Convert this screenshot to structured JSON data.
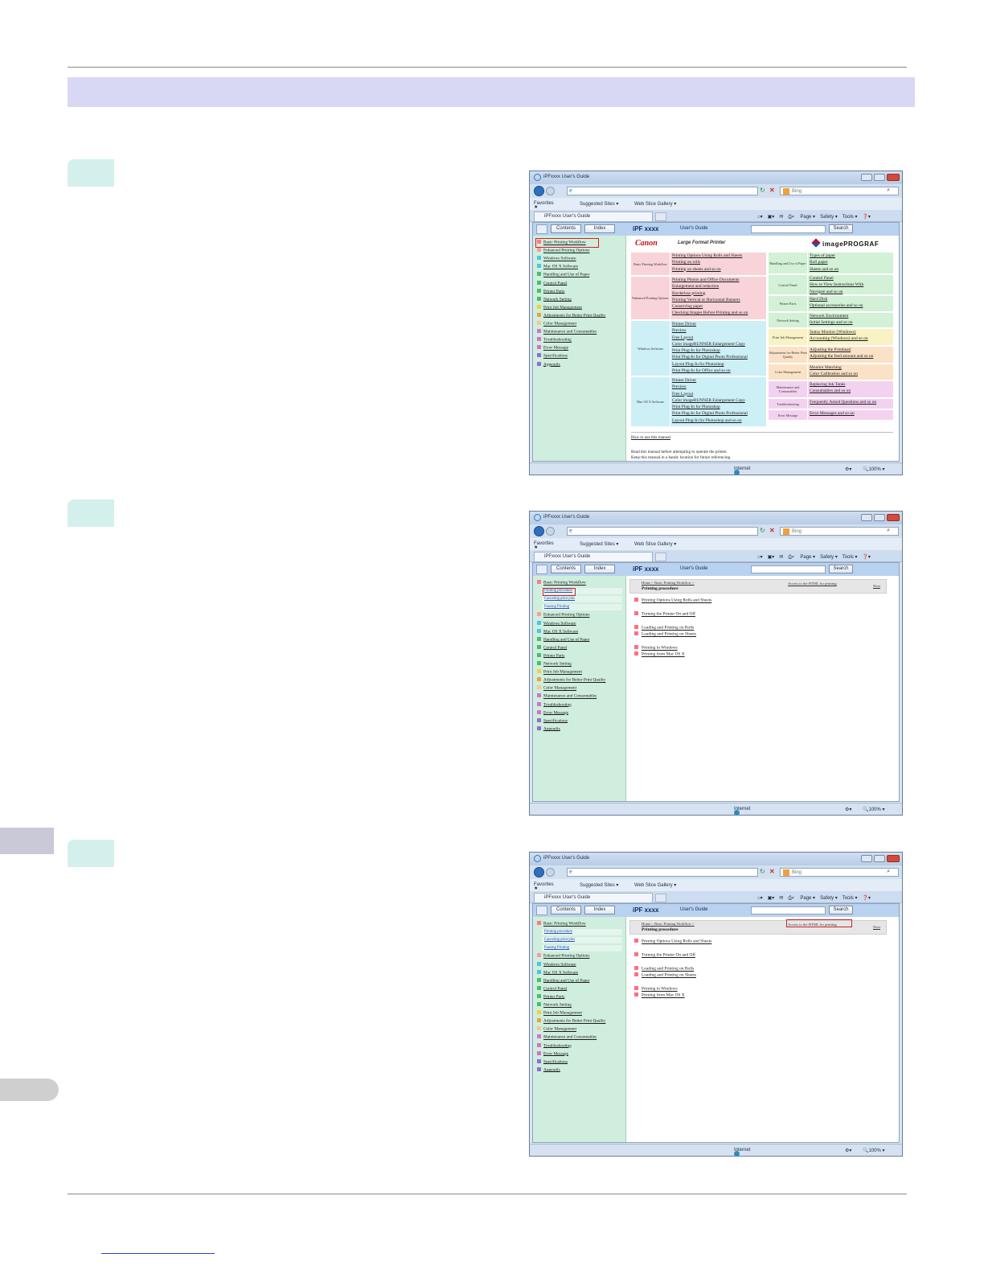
{
  "browser": {
    "window_title": "iPFxxxx User's Guide",
    "tab_title": "iPFxxxx User's Guide",
    "address_icon": "ie-page-icon",
    "search_placeholder": "Bing",
    "favorites_label": "Favorites",
    "suggested_sites": "Suggested Sites ▾",
    "web_slice": "Web Slice Gallery ▾",
    "tools": [
      "Page ▾",
      "Safety ▾",
      "Tools ▾",
      "❓▾"
    ],
    "status_zone": "Internet",
    "zoom": "100%"
  },
  "guide": {
    "contents_button": "Contents",
    "index_button": "Index",
    "brand": "iPF xxxx",
    "guide_label": "User's Guide",
    "search_button": "Search"
  },
  "nav": [
    {
      "label": "Basic Printing Workflow",
      "color": "#ff7a86"
    },
    {
      "label": "Enhanced Printing Options",
      "color": "#ff9aa2"
    },
    {
      "label": "Windows Software",
      "color": "#49c6e5"
    },
    {
      "label": "Mac OS X Software",
      "color": "#49c6e5"
    },
    {
      "label": "Handling and Use of Paper",
      "color": "#45c06a"
    },
    {
      "label": "Control Panel",
      "color": "#45c06a"
    },
    {
      "label": "Printer Parts",
      "color": "#45c06a"
    },
    {
      "label": "Network Setting",
      "color": "#45c06a"
    },
    {
      "label": "Print Job Management",
      "color": "#f0d23a"
    },
    {
      "label": "Adjustments for Better Print Quality",
      "color": "#f0a03a"
    },
    {
      "label": "Color Management",
      "color": "#f5c98a"
    },
    {
      "label": "Maintenance and Consumables",
      "color": "#d96fd1"
    },
    {
      "label": "Troubleshooting",
      "color": "#d96fd1"
    },
    {
      "label": "Error Message",
      "color": "#d96fd1"
    },
    {
      "label": "Specifications",
      "color": "#8f6fd6"
    },
    {
      "label": "Appendix",
      "color": "#8f6fd6"
    }
  ],
  "subnav": [
    "Printing procedure",
    "Canceling print jobs",
    "Pausing Printing"
  ],
  "home": {
    "logo": "Canon",
    "tagline": "Large Format Printer",
    "product": "imagePROGRAF",
    "left_categories": [
      {
        "label": "Basic Printing Workflow",
        "color": "#f8d4d8",
        "links": [
          "Printing Options Using Rolls and Sheets",
          "Printing on rolls",
          "Printing on sheets  and so on"
        ]
      },
      {
        "label": "Enhanced Printing Options",
        "color": "#f8d4d8",
        "links": [
          "Printing Photos and Office Documents",
          "Enlargement and reduction",
          "Borderless printing",
          "Printing Vertical or Horizontal Banners",
          "Conserving paper",
          "Checking Images Before Printing  and so on"
        ]
      },
      {
        "label": "Windows Software",
        "color": "#cdeff6",
        "links": [
          "Printer Driver",
          "Preview",
          "Free Layout",
          "Color imageRUNNER Enlargement Copy",
          "Print Plug-In for Photoshop",
          "Print Plug-In for Digital Photo Professional",
          "Layout Plug-In for Photoshop",
          "Print Plug-In for Office  and so on"
        ]
      },
      {
        "label": "Mac OS X Software",
        "color": "#cdeff6",
        "links": [
          "Printer Driver",
          "Preview",
          "Free Layout",
          "Color imageRUNNER Enlargement Copy",
          "Print Plug-In for Photoshop",
          "Print Plug-In for Digital Photo Professional",
          "Layout Plug-In for Photoshop  and so on"
        ]
      }
    ],
    "right_categories": [
      {
        "label": "Handling and Use of Paper",
        "color": "#d2f1d6",
        "links": [
          "Types of paper",
          "Roll paper",
          "Sheets  and so on"
        ]
      },
      {
        "label": "Control Panel",
        "color": "#d2f1d6",
        "links": [
          "Control Panel",
          "How to View Instructions With",
          "Navigate  and so on"
        ]
      },
      {
        "label": "Printer Parts",
        "color": "#d2f1d6",
        "links": [
          "Hard Disk",
          "Optional accessories  and so on"
        ]
      },
      {
        "label": "Network Setting",
        "color": "#d2f1d6",
        "links": [
          "Network Environment",
          "Initial Settings  and so on"
        ]
      },
      {
        "label": "Print Job Management",
        "color": "#f8f2c4",
        "links": [
          "Status Monitor (Windows)",
          "Accounting (Windows)  and so on"
        ]
      },
      {
        "label": "Adjustments for Better Print Quality",
        "color": "#fbe2c6",
        "links": [
          "Adjusting the Printhead",
          "Adjusting the feed amount  and so on"
        ]
      },
      {
        "label": "Color Management",
        "color": "#fbe2c6",
        "links": [
          "Monitor Matching",
          "Color Calibration  and so on"
        ]
      },
      {
        "label": "Maintenance and Consumables",
        "color": "#f3d2ef",
        "links": [
          "Replacing Ink Tanks",
          "Consumables  and so on"
        ]
      },
      {
        "label": "Troubleshooting",
        "color": "#f3d2ef",
        "links": [
          "Frequently Asked Questions  and so on"
        ]
      },
      {
        "label": "Error Message",
        "color": "#f3d2ef",
        "links": [
          "Error Messages  and so on"
        ]
      }
    ],
    "how_to_use": "How to use this manual",
    "note_line1": "Read this manual before attempting to operate the printer.",
    "note_line2": "Keep this manual in a handy location for future referencing."
  },
  "procedure": {
    "crumb": "Home > Basic Printing Workflow >",
    "title": "Printing procedure",
    "access_link": "Access to the HTML for printing",
    "next": "Next",
    "topics": [
      "Printing Options Using Rolls and Sheets",
      "Turning the Printer On and Off",
      "Loading and Printing on Rolls",
      "Loading and Printing on Sheets",
      "Printing in Windows",
      "Printing from Mac OS X"
    ]
  }
}
